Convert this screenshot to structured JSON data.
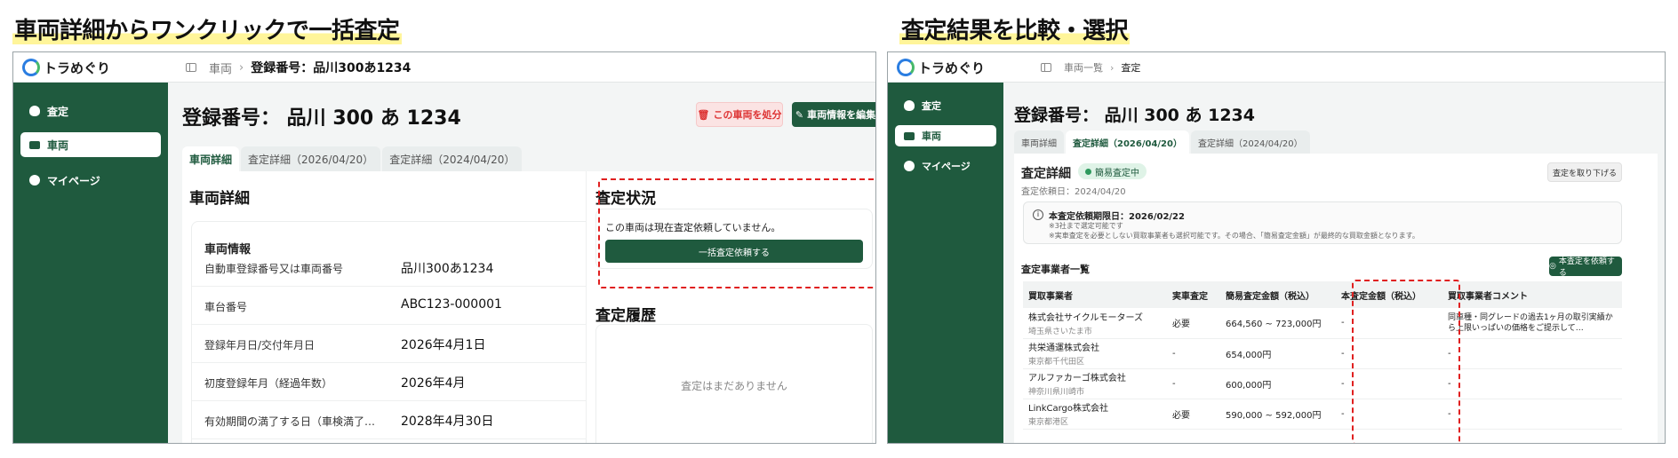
{
  "captions": {
    "left": "車両詳細からワンクリックで一括査定",
    "right": "査定結果を比較・選択"
  },
  "app": {
    "brand": "トラめぐり"
  },
  "sidebar": {
    "items": [
      {
        "label": "査定",
        "icon": "piggy-bank-icon"
      },
      {
        "label": "車両",
        "icon": "truck-icon",
        "active": true
      },
      {
        "label": "マイページ",
        "icon": "user-icon"
      }
    ]
  },
  "left": {
    "breadcrumb": {
      "root": "車両",
      "current": "登録番号：品川300あ1234"
    },
    "title": "登録番号： 品川 300 あ 1234",
    "buttons": {
      "dispose": "この車両を処分",
      "edit": "車両情報を編集"
    },
    "tabs": [
      "車両詳細",
      "査定詳細（2026/04/20）",
      "査定詳細（2024/04/20）"
    ],
    "vehicle_detail_heading": "車両詳細",
    "vehicle_info_heading": "車両情報",
    "rows": [
      {
        "key": "自動車登録番号又は車両番号",
        "value": "品川300あ1234"
      },
      {
        "key": "車台番号",
        "value": "ABC123-000001"
      },
      {
        "key": "登録年月日/交付年月日",
        "value": "2026年4月1日"
      },
      {
        "key": "初度登録年月（経過年数）",
        "value": "2026年4月"
      },
      {
        "key": "有効期間の満了する日（車検満了…",
        "value": "2028年4月30日"
      }
    ],
    "status": {
      "heading": "査定状況",
      "message": "この車両は現在査定依頼していません。",
      "button": "一括査定依頼する"
    },
    "history": {
      "heading": "査定履歴",
      "empty": "査定はまだありません"
    }
  },
  "right": {
    "breadcrumb": {
      "root": "車両一覧",
      "current": "査定"
    },
    "title": "登録番号： 品川 300 あ 1234",
    "tabs": [
      "車両詳細",
      "査定詳細（2026/04/20）",
      "査定詳細（2024/04/20）"
    ],
    "detail_heading": "査定詳細",
    "badge": "簡易査定中",
    "request_date": "査定依頼日：2024/04/20",
    "withdraw_button": "査定を取り下げる",
    "notice": {
      "title": "本査定依頼期限日：2026/02/22",
      "line1": "※3社まで選定可能です",
      "line2": "※実車査定を必要としない買取事業者も選択可能です。その場合、「簡易査定金額」が最終的な買取金額となります。"
    },
    "list_heading": "査定事業者一覧",
    "request_button": "本査定を依頼する",
    "table": {
      "headers": [
        "買取事業者",
        "実車査定",
        "簡易査定金額（税込）",
        "本査定金額（税込）",
        "買取事業者コメント"
      ],
      "rows": [
        {
          "name": "株式会社サイクルモーターズ",
          "area": "埼玉県さいたま市",
          "inspect": "必要",
          "quick": "664,560 ~ 723,000円",
          "final": "-",
          "comment": "同車種・同グレードの過去1ヶ月の取引実績から上限いっぱいの価格をご提示して…"
        },
        {
          "name": "共栄通運株式会社",
          "area": "東京都千代田区",
          "inspect": "-",
          "quick": "654,000円",
          "final": "-",
          "comment": "-"
        },
        {
          "name": "アルファカーゴ株式会社",
          "area": "神奈川県川崎市",
          "inspect": "-",
          "quick": "600,000円",
          "final": "-",
          "comment": "-"
        },
        {
          "name": "LinkCargo株式会社",
          "area": "東京都港区",
          "inspect": "必要",
          "quick": "590,000 ~ 592,000円",
          "final": "-",
          "comment": "-"
        }
      ]
    }
  },
  "colors": {
    "brand": "#1f5a3e",
    "highlight": "#e02020",
    "caption_marker": "#fff59a"
  }
}
